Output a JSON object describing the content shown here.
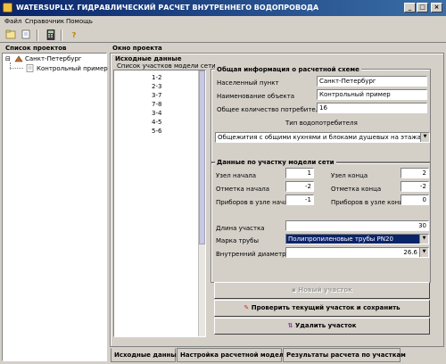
{
  "window": {
    "title": "WATERSUPLLY. ГИДРАВЛИЧЕСКИЙ РАСЧЕТ ВНУТРЕННЕГО ВОДОПРОВОДА",
    "controls": [
      "_",
      "□",
      "×"
    ]
  },
  "menu": [
    "Файл",
    "Справочник",
    "Помощь"
  ],
  "toolbar": {
    "icons": [
      "open-icon",
      "new-icon",
      "calculator-icon",
      "help-icon"
    ],
    "help_glyph": "?"
  },
  "left": {
    "title": "Список проектов",
    "tree": {
      "expander": "⊟",
      "root": "Санкт-Петербург",
      "child": "Контрольный пример"
    }
  },
  "right": {
    "title": "Окно проекта",
    "section_title": "Исходные данные",
    "segments_title": "Список участков модели сети",
    "segments": [
      "1-2",
      "2-3",
      "3-7",
      "7-8",
      "3-4",
      "4-5",
      "5-6"
    ]
  },
  "general": {
    "title": "Общая информация о расчетной схеме",
    "city_label": "Населенный пункт",
    "city_value": "Санкт-Петербург",
    "object_label": "Наименование объекта",
    "object_value": "Контрольный пример",
    "consumers_label": "Общее количество потребителей",
    "consumers_value": "16",
    "consumer_type_label": "Тип водопотребителя",
    "consumer_type_value": "Общежития с общими кухнями и блоками душевых на этажах при жил"
  },
  "segment": {
    "title": "Данные по участку модели сети",
    "start_node_label": "Узел начала",
    "start_node_value": "1",
    "end_node_label": "Узел конца",
    "end_node_value": "2",
    "start_mark_label": "Отметка начала",
    "start_mark_value": "-2",
    "end_mark_label": "Отметка конца",
    "end_mark_value": "-2",
    "start_devices_label": "Приборов в узле начала",
    "start_devices_value": "-1",
    "end_devices_label": "Приборов в узле конца",
    "end_devices_value": "0",
    "length_label": "Длина участка",
    "length_value": "30",
    "pipe_label": "Марка трубы",
    "pipe_value": "Полипропиленовые трубы PN20",
    "diameter_label": "Внутренний диаметр",
    "diameter_value": "26.6"
  },
  "buttons": {
    "new_segment": "Новый участок",
    "check_save": "Проверить текущий участок и сохранить",
    "delete": "Удалить участок"
  },
  "tabs": [
    "Исходные данные",
    "Настройка расчетной модели",
    "Результаты расчета по участкам"
  ],
  "colors": {
    "title_bar": "#0a246a",
    "selection": "#0a246a",
    "face": "#d4d0c8"
  }
}
